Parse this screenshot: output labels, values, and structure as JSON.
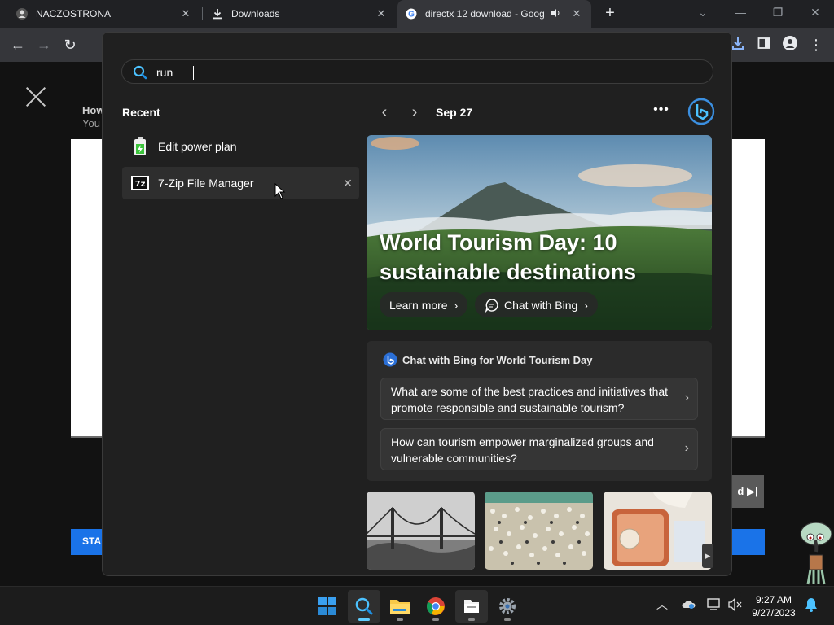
{
  "browser": {
    "tabs": [
      {
        "title": "NACZOSTRONA",
        "close": "✕"
      },
      {
        "title": "Downloads",
        "close": "✕"
      },
      {
        "title": "directx 12 download - Goog",
        "close": "✕"
      }
    ],
    "new_tab": "+"
  },
  "page": {
    "heading": "How",
    "subheading": "You",
    "button_text": "STA",
    "side_button_text": "d ▶|"
  },
  "search": {
    "query": "run",
    "recent_title": "Recent",
    "recent_items": [
      {
        "label": "Edit power plan",
        "icon": "battery-icon"
      },
      {
        "label": "7-Zip File Manager",
        "icon": "7zip-icon",
        "remove": "✕"
      }
    ],
    "date": "Sep 27",
    "hero": {
      "title": "World Tourism Day: 10 sustainable destinations",
      "learn_more": "Learn more",
      "chat_with_bing": "Chat with Bing"
    },
    "bing_card": {
      "title": "Chat with Bing for World Tourism Day",
      "questions": [
        "What are some of the best practices and initiatives that promote responsible and sustainable tourism?",
        "How can tourism empower marginalized groups and vulnerable communities?"
      ]
    },
    "thumbnails": [
      "bridge-photo",
      "crowd-photo",
      "suitcase-photo"
    ]
  },
  "taskbar": {
    "apps": [
      "windows-start",
      "search",
      "file-explorer",
      "chrome",
      "files-app",
      "settings"
    ],
    "time": "9:27 AM",
    "date": "9/27/2023"
  },
  "colors": {
    "accent": "#60cdff",
    "flyout_bg": "#202020",
    "blue_bar": "#1a73e8"
  }
}
